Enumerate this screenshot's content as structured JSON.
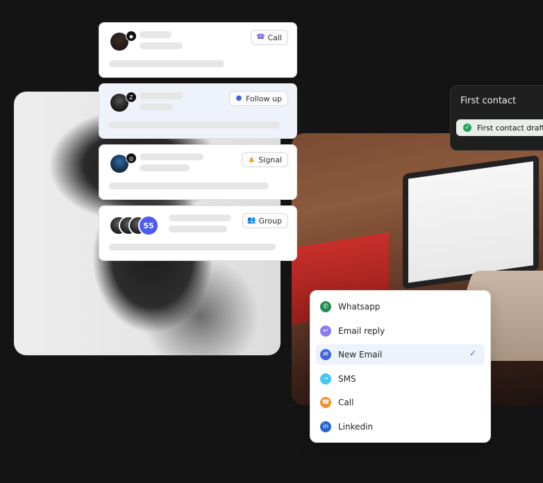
{
  "dark_card": {
    "title": "First contact",
    "status": "First contact draft wa"
  },
  "activities": [
    {
      "tag": "Call",
      "tag_icon": "phone-icon",
      "accent": "#6c4fd8"
    },
    {
      "tag": "Follow up",
      "tag_icon": "follow-up-icon",
      "accent": "#3a5fe6"
    },
    {
      "tag": "Signal",
      "tag_icon": "bell-icon",
      "accent": "#e6a21c"
    },
    {
      "tag": "Group",
      "tag_icon": "group-icon",
      "accent": "#e6a21c",
      "group_count": "55"
    }
  ],
  "menu": {
    "selected": "New Email",
    "items": [
      {
        "label": "Whatsapp",
        "icon": "whatsapp-icon",
        "color": "#1e8d4f"
      },
      {
        "label": "Email reply",
        "icon": "reply-icon",
        "color": "#8a7cf0"
      },
      {
        "label": "New Email",
        "icon": "email-icon",
        "color": "#4166d8"
      },
      {
        "label": "SMS",
        "icon": "sms-icon",
        "color": "#40c7f2"
      },
      {
        "label": "Call",
        "icon": "phone-icon",
        "color": "#f18e2d"
      },
      {
        "label": "Linkedin",
        "icon": "linkedin-icon",
        "color": "#2563cc"
      }
    ]
  }
}
